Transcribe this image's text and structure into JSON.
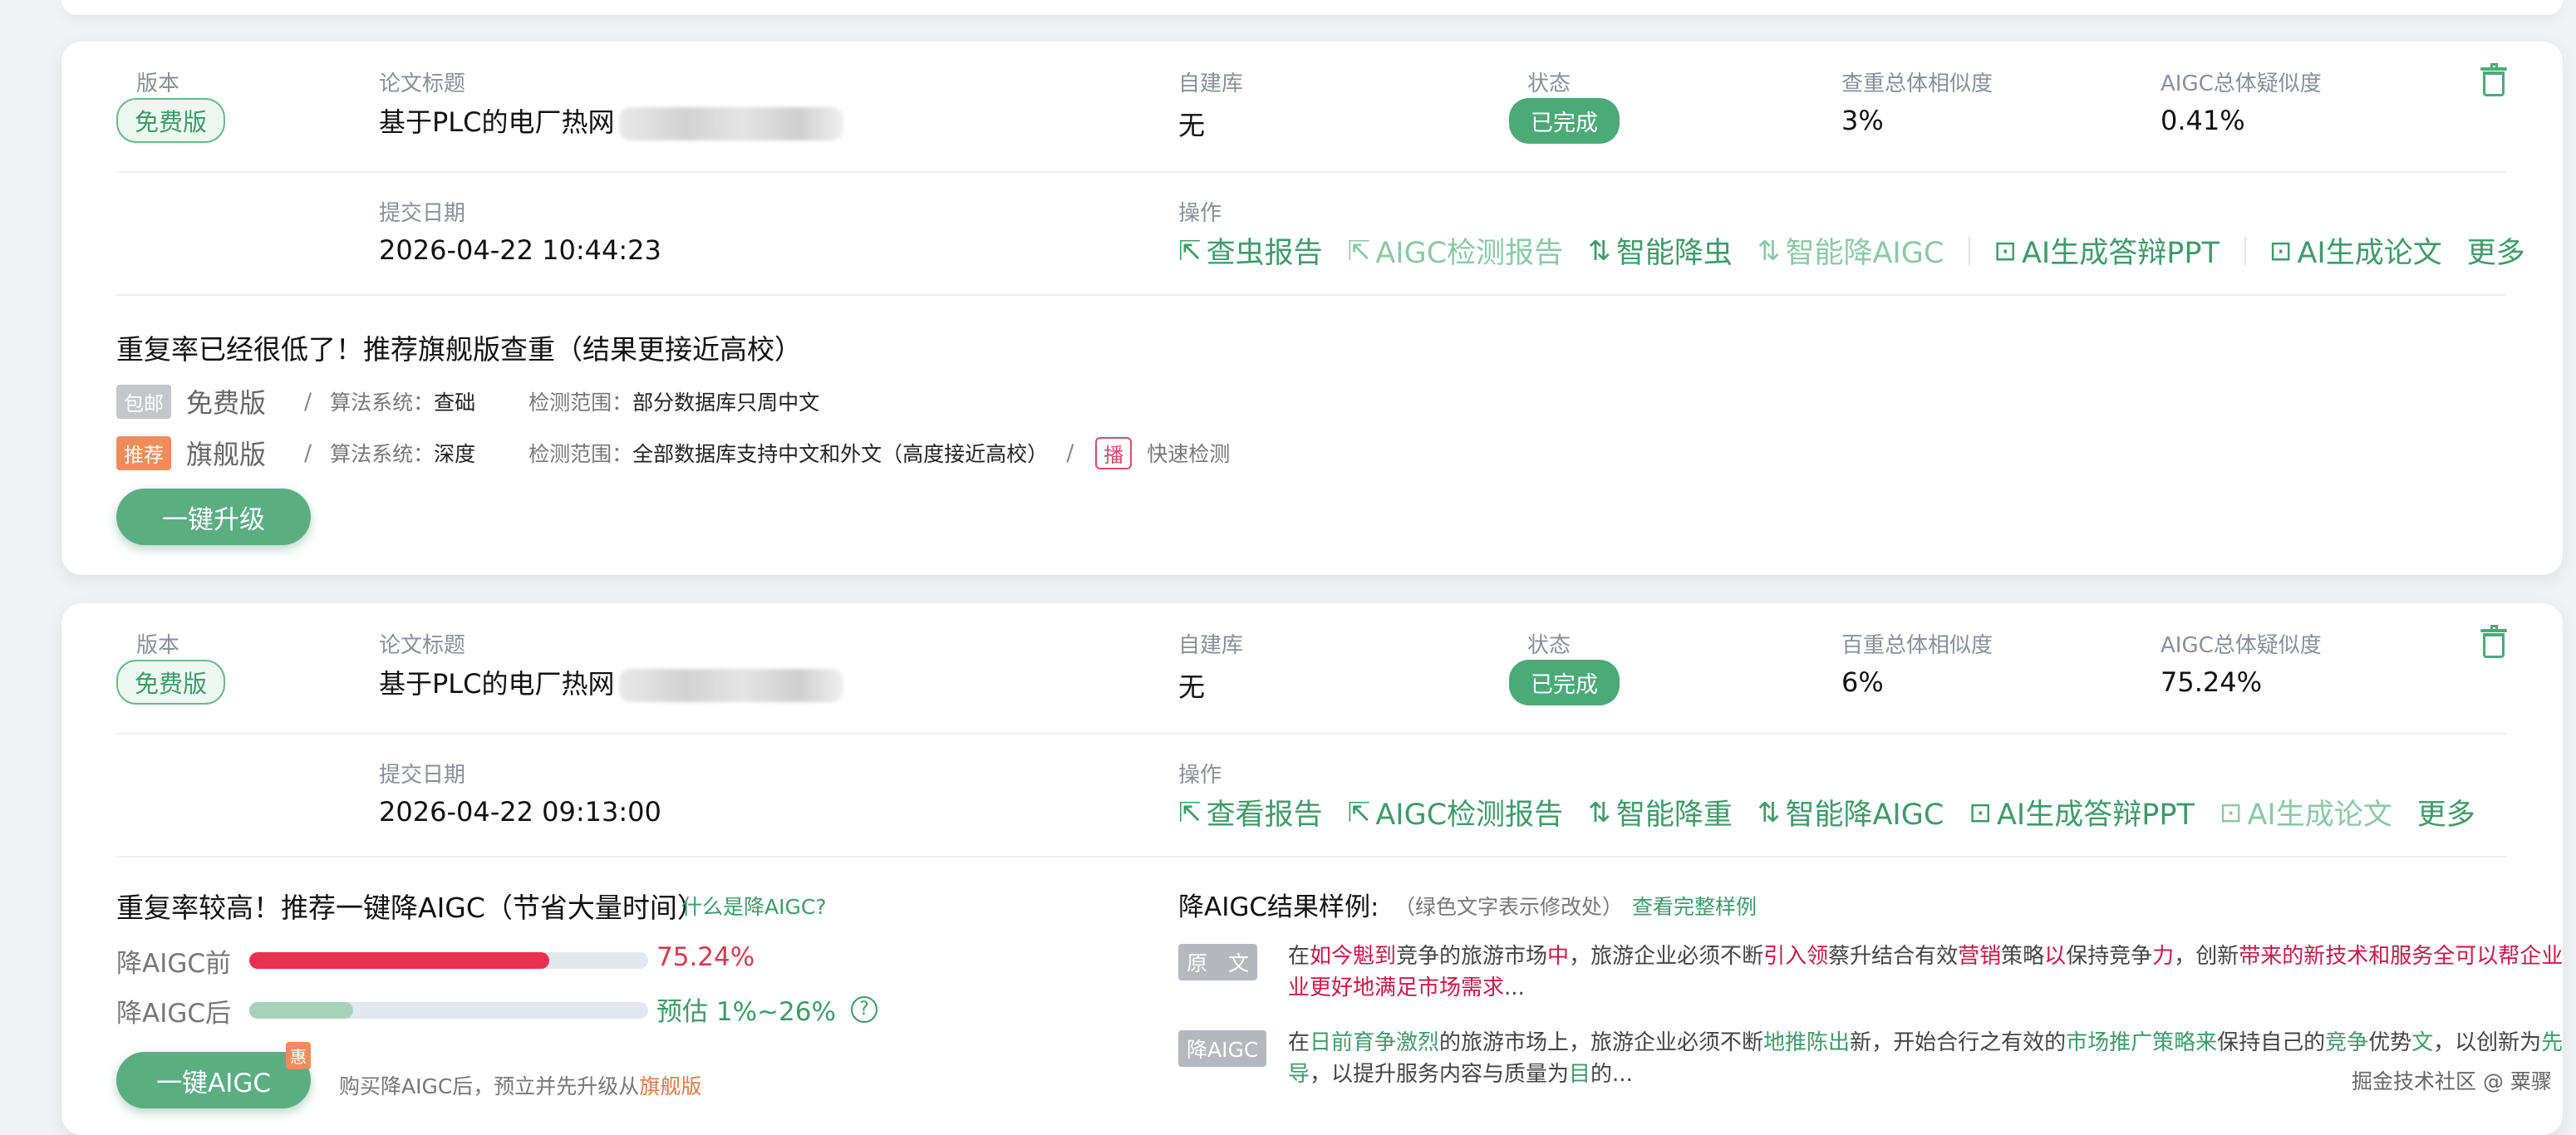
{
  "labels": {
    "version": "版本",
    "title": "论文标题",
    "selfdb": "自建库",
    "status": "状态",
    "submit_date": "提交日期",
    "ops": "操作"
  },
  "cards": [
    {
      "version": "免费版",
      "title": "基于PLC的电厂热网",
      "selfdb": "无",
      "status": "已完成",
      "sim_label": "查重总体相似度",
      "sim_value": "3%",
      "aigc_label": "AIGC总体疑似度",
      "aigc_value": "0.41%",
      "date": "2026-04-22 10:44:23",
      "ops": [
        "查虫报告",
        "AIGC检测报告",
        "智能降虫",
        "智能降AIGC",
        "AI生成答辩PPT",
        "AI生成论文",
        "更多"
      ],
      "rec_title": "重复率已经很低了！推荐旗舰版查重（结果更接近高校）",
      "plan1": {
        "tag": "包邮",
        "name": "免费版",
        "algo_label": "算法系统：",
        "algo": "查础",
        "range_label": "检测范围：",
        "range": "部分数据库只周中文"
      },
      "plan2": {
        "tag": "推荐",
        "name": "旗舰版",
        "algo_label": "算法系统：",
        "algo": "深度",
        "range_label": "检测范围：",
        "range": "全部数据库支持中文和外文（高度接近高校）",
        "box": "播",
        "fast": "快速检测"
      },
      "button": "一键升级"
    },
    {
      "version": "免费版",
      "title": "基于PLC的电厂热网",
      "selfdb": "无",
      "status": "已完成",
      "sim_label": "百重总体相似度",
      "sim_value": "6%",
      "aigc_label": "AIGC总体疑似度",
      "aigc_value": "75.24%",
      "date": "2026-04-22 09:13:00",
      "ops": [
        "查看报告",
        "AIGC检测报告",
        "智能降重",
        "智能降AIGC",
        "AI生成答辩PPT",
        "AI生成论文",
        "更多"
      ],
      "rec_title": "重复率较高！推荐一键降AIGC（节省大量时间）",
      "rec_link": "什么是降AIGC?",
      "before_label": "降AIGC前",
      "before_value": "75.24%",
      "before_fraction": 0.7524,
      "after_label": "降AIGC后",
      "after_value": "预估 1%~26%",
      "after_fraction": 0.26,
      "button": "一键AIGC",
      "button_badge": "惠",
      "footer_note": "购买降AIGC后，预立并先升级从",
      "footer_highlight": "旗舰版",
      "sample_title": "降AIGC结果样例:",
      "sample_note": "（绿色文字表示修改处）",
      "sample_link": "查看完整样例",
      "orig_tag": "原　文",
      "orig_segments": [
        {
          "t": "在",
          "c": ""
        },
        {
          "t": "如今魁到",
          "c": "red"
        },
        {
          "t": "竞争的旅游市场",
          "c": ""
        },
        {
          "t": "中",
          "c": "red"
        },
        {
          "t": "，旅游企业必须不断",
          "c": ""
        },
        {
          "t": "引入领",
          "c": "red"
        },
        {
          "t": "蔡升结合有效",
          "c": ""
        },
        {
          "t": "营销",
          "c": "red"
        },
        {
          "t": "策略",
          "c": ""
        },
        {
          "t": "以",
          "c": "red"
        },
        {
          "t": "保持竞争",
          "c": ""
        },
        {
          "t": "力",
          "c": "red"
        },
        {
          "t": "，创新",
          "c": ""
        },
        {
          "t": "带来的新技术和服务全可以帮企业业更好地满足市场需求",
          "c": "red"
        },
        {
          "t": "...",
          "c": ""
        }
      ],
      "new_tag": "降AIGC",
      "new_segments": [
        {
          "t": "在",
          "c": ""
        },
        {
          "t": "日前育争激烈",
          "c": "green"
        },
        {
          "t": "的旅游市场上，旅游企业必须不断",
          "c": ""
        },
        {
          "t": "地推陈出",
          "c": "green"
        },
        {
          "t": "新，开始合行之有效的",
          "c": ""
        },
        {
          "t": "市场推广策略来",
          "c": "green"
        },
        {
          "t": "保持自己的",
          "c": ""
        },
        {
          "t": "竞争",
          "c": "green"
        },
        {
          "t": "优势",
          "c": ""
        },
        {
          "t": "文",
          "c": "green"
        },
        {
          "t": "，以创新为",
          "c": ""
        },
        {
          "t": "先导",
          "c": "green"
        },
        {
          "t": "，以提升服务内容与质量为",
          "c": ""
        },
        {
          "t": "目",
          "c": "green"
        },
        {
          "t": "的...",
          "c": ""
        }
      ]
    }
  ],
  "watermark": "掘金技术社区 @ 粟骤",
  "colors": {
    "accent": "#4caa78",
    "red_bar": "#e8314f",
    "muted_bar": "#a6d2ba"
  },
  "icons": [
    "trash-icon",
    "external-link-icon",
    "sort-icon",
    "robot-icon",
    "question-icon"
  ]
}
